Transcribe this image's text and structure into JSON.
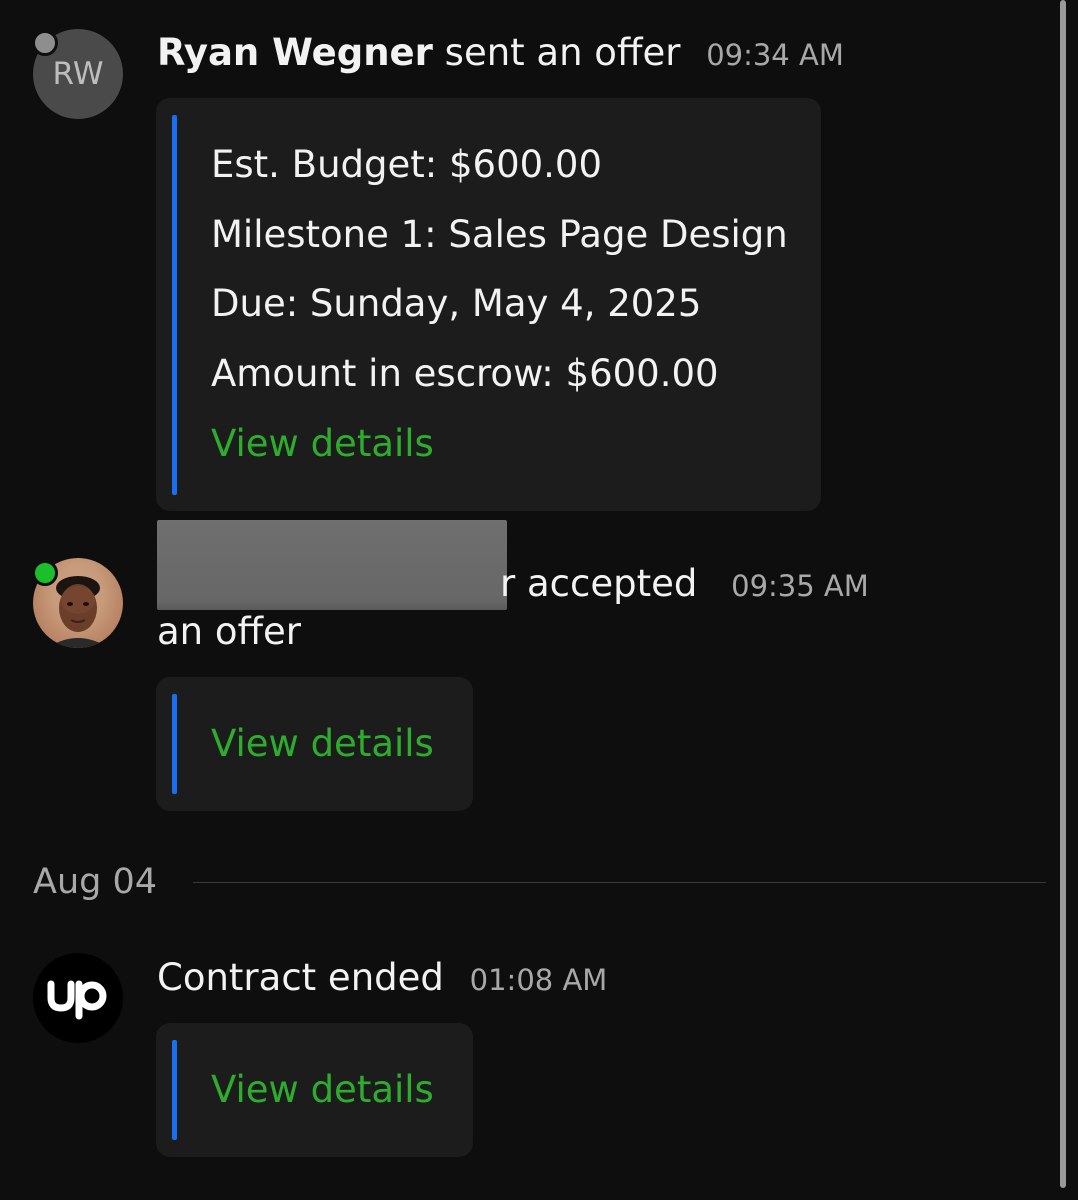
{
  "messages": [
    {
      "avatar_initials": "RW",
      "sender": "Ryan Wegner",
      "action": " sent an offer",
      "time": "09:34 AM",
      "card_lines": [
        "Est. Budget: $600.00",
        "Milestone 1: Sales Page Design",
        "Due: Sunday, May 4, 2025",
        "Amount in escrow: $600.00"
      ],
      "link": "View details"
    },
    {
      "sender_visible_fragment": "r",
      "action": " accepted",
      "action_wrap": "an offer",
      "time": "09:35 AM",
      "link": "View details"
    },
    {
      "action": "Contract ended",
      "time": "01:08 AM",
      "link": "View details"
    }
  ],
  "date_separator": "Aug 04",
  "colors": {
    "background": "#0e0e0e",
    "card": "#1c1c1c",
    "accent_bar": "#1a6ef0",
    "link": "#2cae2c",
    "online": "#1bbf2b",
    "offline": "#8e8e8e"
  }
}
